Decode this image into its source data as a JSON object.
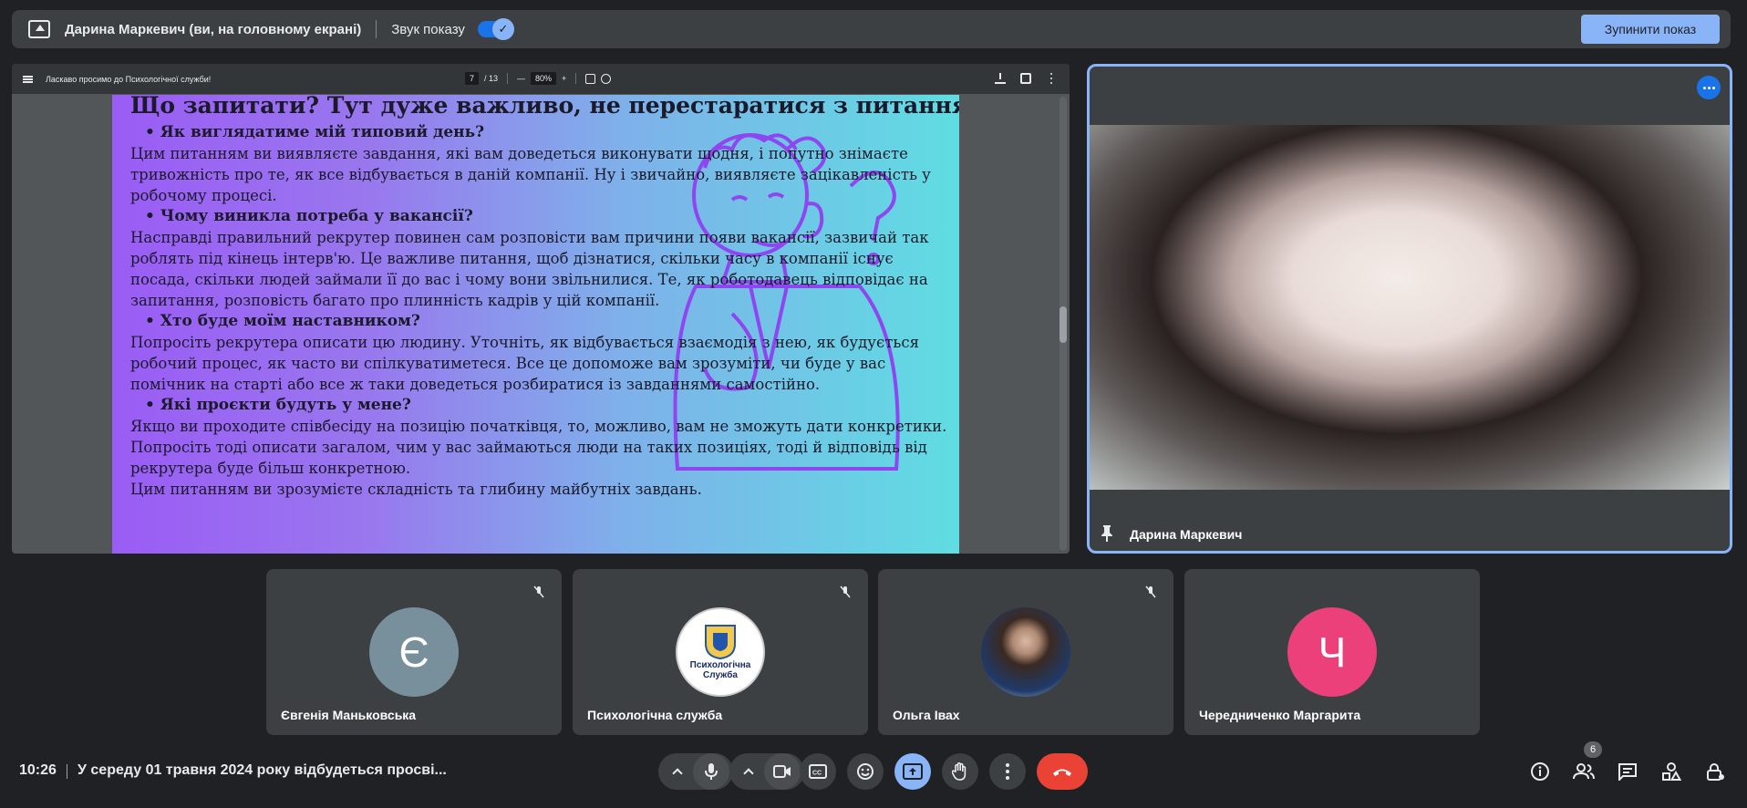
{
  "topbar": {
    "presenter_title": "Дарина Маркевич (ви, на головному екрані)",
    "sound_label": "Звук показу",
    "sound_on": true,
    "stop_label": "Зупинити показ"
  },
  "pdf": {
    "title": "Ласкаво просимо до Психологічної служби!",
    "page_current": "7",
    "page_total": "/ 13",
    "zoom": "80%"
  },
  "slide": {
    "heading": "Що запитати? Тут дуже важливо, не перестаратися з питаннями!",
    "sections": [
      {
        "bullet": "Як виглядатиме мій типовий день?",
        "text": "Цим питанням ви виявляєте завдання, які вам доведеться виконувати щодня, і попутно знімаєте тривожність про те, як все відбувається в даній компанії. Ну і звичайно, виявляєте зацікавленість у робочому процесі."
      },
      {
        "bullet": "Чому виникла потреба у вакансії?",
        "text": "Насправді правильний рекрутер повинен сам розповісти вам причини появи вакансії, зазвичай так роблять під кінець інтерв'ю. Це важливе питання, щоб дізнатися, скільки часу в компанії існує посада, скільки людей займали її до вас і чому вони звільнилися. Те, як роботодавець відповідає на запитання, розповість багато про плинність кадрів у цій компанії."
      },
      {
        "bullet": "Хто буде моїм наставником?",
        "text": "Попросіть рекрутера описати цю людину. Уточніть, як відбувається взаємодія з нею, як будується робочий процес, як часто ви спілкуватиметеся. Все це допоможе вам зрозуміти, чи буде у вас помічник на старті або все ж таки доведеться розбиратися із завданнями самостійно."
      },
      {
        "bullet": "Які проєкти будуть у мене?",
        "text": "Якщо ви проходите співбесіду на позицію початківця, то, можливо, вам не зможуть дати конкретики. Попросіть тоді описати загалом, чим у вас займаються люди на таких позиціях, тоді й відповідь від рекрутера буде більш конкретною."
      }
    ],
    "closing": "Цим питанням ви зрозумієте складність та глибину майбутніх завдань."
  },
  "speaker": {
    "name": "Дарина Маркевич"
  },
  "participants": [
    {
      "name": "Євгенія Маньковська",
      "initial": "Є",
      "avatar_color": "#78909c",
      "muted": true
    },
    {
      "name": "Психологічна служба",
      "initial": "",
      "avatar_color": "#ffffff",
      "muted": true,
      "logo_text": "Психологічна Служба"
    },
    {
      "name": "Ольга Івах",
      "initial": "",
      "avatar_color": "#5d4a3e",
      "muted": true
    },
    {
      "name": "Чередниченко Маргарита",
      "initial": "Ч",
      "avatar_color": "#ec407a",
      "muted": false
    }
  ],
  "bottombar": {
    "time": "10:26",
    "meeting_title": "У середу 01 травня 2024 року відбудеться просві...",
    "participant_count": "6"
  }
}
